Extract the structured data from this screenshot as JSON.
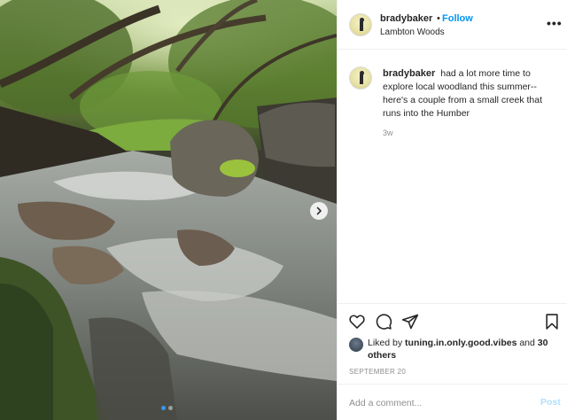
{
  "header": {
    "username": "bradybaker",
    "separator": "•",
    "follow_label": "Follow",
    "location": "Lambton Woods",
    "more_label": "•••"
  },
  "caption": {
    "username": "bradybaker",
    "text": "had a lot more time to explore local woodland this summer--here's a couple from a small creek that runs into the Humber",
    "age": "3w"
  },
  "actions": {
    "icons": [
      "heart-icon",
      "comment-icon",
      "share-icon",
      "bookmark-icon"
    ]
  },
  "likes": {
    "prefix": "Liked by",
    "liker": "tuning.in.only.good.vibes",
    "and": "and",
    "others": "30 others"
  },
  "date": "SEPTEMBER 20",
  "comment": {
    "placeholder": "Add a comment...",
    "post_label": "Post"
  },
  "carousel": {
    "slide_count": 2,
    "active_index": 0
  },
  "colors": {
    "follow": "#0095f6",
    "post_disabled": "#b2dffc",
    "active_dot": "#3897f0"
  }
}
